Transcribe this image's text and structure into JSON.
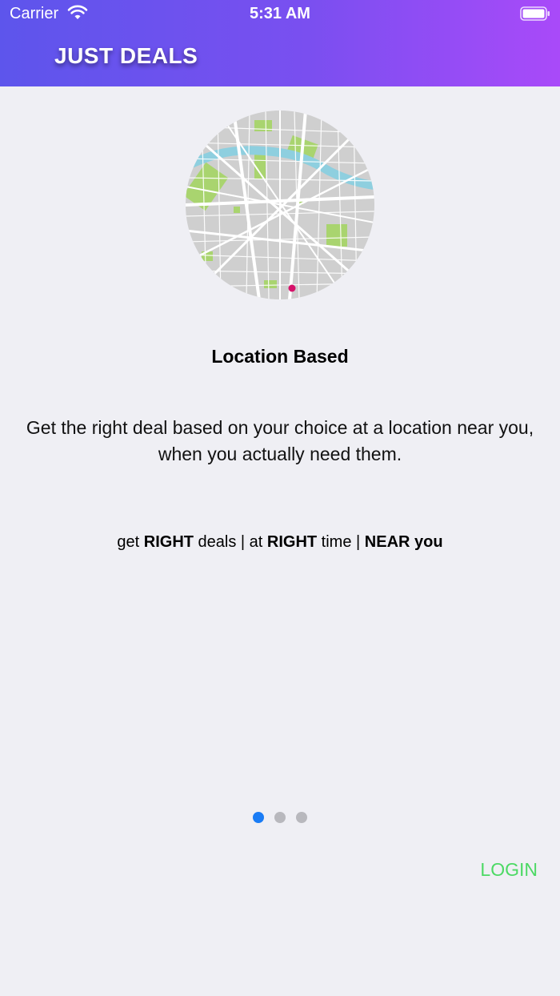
{
  "status_bar": {
    "carrier": "Carrier",
    "time": "5:31 AM"
  },
  "header": {
    "title": "JUST DEALS"
  },
  "slide": {
    "illustration": "map-icon",
    "title": "Location Based",
    "description": "Get the right deal based on your choice at a location near you, when you actually need them."
  },
  "tagline": {
    "part1": "get ",
    "bold1": "RIGHT",
    "part2": " deals | at ",
    "bold2": "RIGHT",
    "part3": " time | ",
    "bold3": "NEAR you"
  },
  "pager": {
    "total": 3,
    "current": 1
  },
  "actions": {
    "login_label": "LOGIN"
  },
  "colors": {
    "header_start": "#5d55ec",
    "header_end": "#a94af9",
    "background": "#efeff4",
    "active_dot": "#1a7cf5",
    "login": "#4cd964",
    "map_pin": "#d6126a"
  }
}
